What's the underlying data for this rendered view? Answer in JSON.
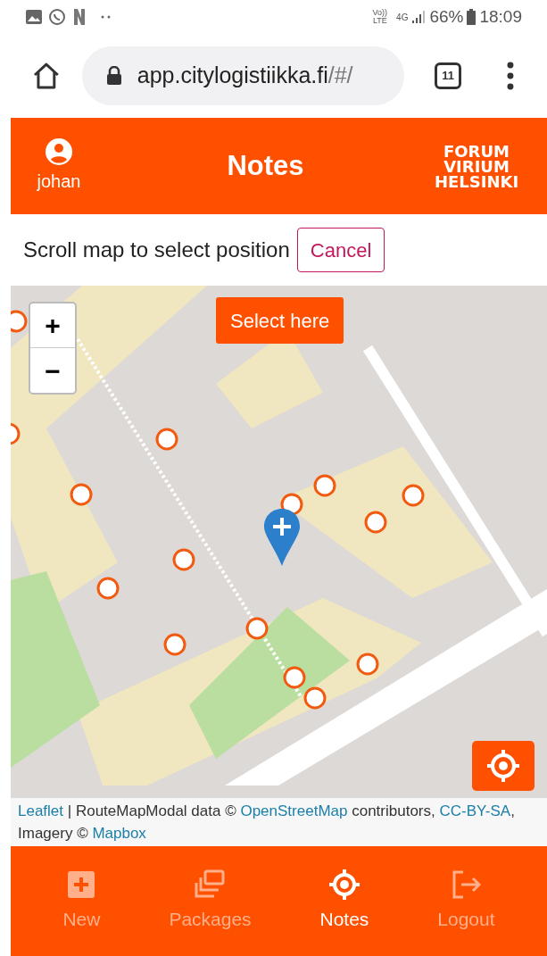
{
  "status_bar": {
    "volte_top": "Vo))",
    "volte_bottom": "LTE",
    "network": "4G",
    "battery": "66%",
    "time": "18:09"
  },
  "browser": {
    "url_main": "app.citylogistiikka.fi",
    "url_rest": "/#/",
    "tab_count": "11"
  },
  "header": {
    "user": "johan",
    "title": "Notes",
    "logo_lines": [
      "FORUM",
      "VIRIUM",
      "HELSINKI"
    ]
  },
  "prompt": {
    "text": "Scroll map to select position",
    "cancel": "Cancel"
  },
  "map": {
    "select_button": "Select here",
    "zoom_in": "+",
    "zoom_out": "−",
    "attribution": [
      {
        "kind": "link",
        "text": "Leaflet"
      },
      {
        "kind": "text",
        "text": " | RouteMapModal data © "
      },
      {
        "kind": "link",
        "text": "OpenStreetMap"
      },
      {
        "kind": "text",
        "text": " contributors, "
      },
      {
        "kind": "link",
        "text": "CC-BY-SA"
      },
      {
        "kind": "text",
        "text": ", Imagery © "
      },
      {
        "kind": "link",
        "text": "Mapbox"
      }
    ]
  },
  "nav": [
    {
      "label": "New",
      "kind": "plus",
      "selected": false
    },
    {
      "label": "Packages",
      "kind": "stack",
      "selected": false
    },
    {
      "label": "Notes",
      "kind": "target",
      "selected": true
    },
    {
      "label": "Logout",
      "kind": "logout",
      "selected": false
    }
  ]
}
